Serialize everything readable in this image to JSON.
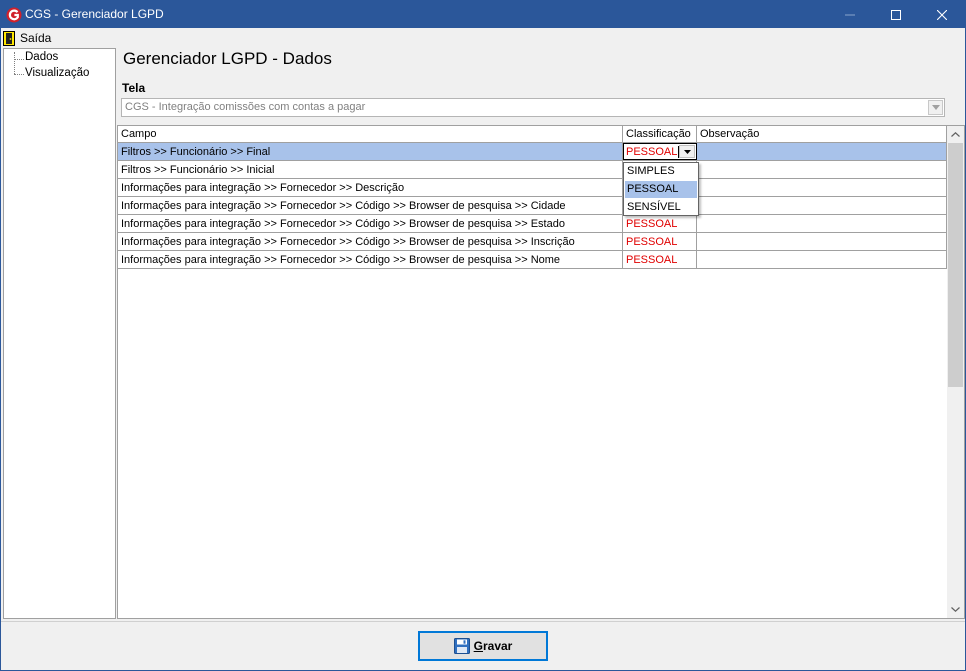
{
  "window": {
    "title": "CGS - Gerenciador LGPD"
  },
  "menu": {
    "items": [
      {
        "label": "Saída",
        "icon": "exit-door-icon"
      }
    ]
  },
  "tree": {
    "items": [
      {
        "label": "Dados"
      },
      {
        "label": "Visualização"
      }
    ]
  },
  "main": {
    "heading": "Gerenciador LGPD - Dados",
    "tela_label": "Tela",
    "tela_value": "CGS - Integração comissões com contas a pagar"
  },
  "grid": {
    "columns": [
      "Campo",
      "Classificação",
      "Observação"
    ],
    "rows": [
      {
        "campo": "Filtros >> Funcionário >> Final",
        "classificacao": "PESSOAL",
        "observacao": "",
        "selected": true
      },
      {
        "campo": "Filtros >> Funcionário >> Inicial",
        "classificacao": "",
        "observacao": ""
      },
      {
        "campo": "Informações para integração >> Fornecedor >> Descrição",
        "classificacao": "",
        "observacao": ""
      },
      {
        "campo": "Informações para integração >> Fornecedor >> Código >> Browser de pesquisa >> Cidade",
        "classificacao": "",
        "observacao": ""
      },
      {
        "campo": "Informações para integração >> Fornecedor >> Código >> Browser de pesquisa >> Estado",
        "classificacao": "PESSOAL",
        "observacao": ""
      },
      {
        "campo": "Informações para integração >> Fornecedor >> Código >> Browser de pesquisa >> Inscrição",
        "classificacao": "PESSOAL",
        "observacao": ""
      },
      {
        "campo": "Informações para integração >> Fornecedor >> Código >> Browser de pesquisa >> Nome",
        "classificacao": "PESSOAL",
        "observacao": ""
      }
    ],
    "editor_value": "PESSOAL",
    "dropdown_options": [
      "SIMPLES",
      "PESSOAL",
      "SENSÍVEL"
    ],
    "dropdown_highlighted": "PESSOAL"
  },
  "footer": {
    "save_prefix": "G",
    "save_rest": "ravar"
  },
  "colors": {
    "titlebar": "#2b579a",
    "selection": "#a8c2ea",
    "pessoal": "#e00000",
    "accent_border": "#0078d7"
  }
}
